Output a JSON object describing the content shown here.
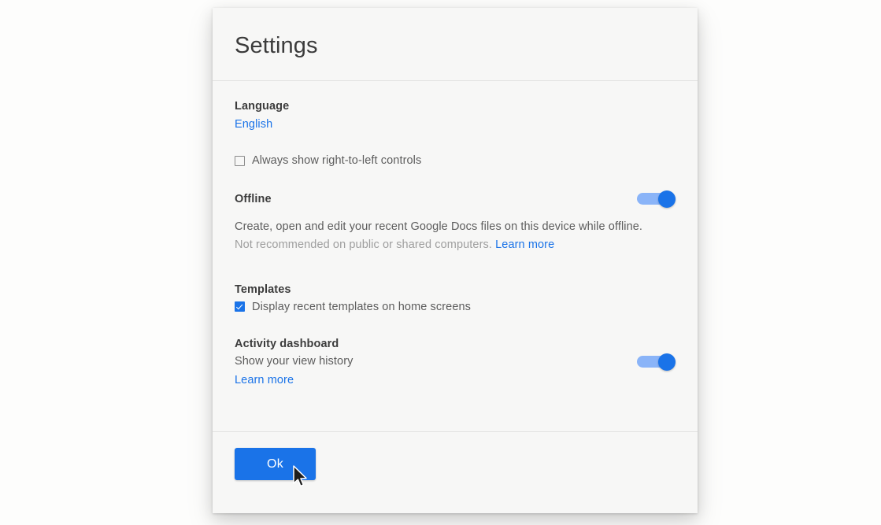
{
  "dialog": {
    "title": "Settings",
    "language": {
      "label": "Language",
      "value": "English",
      "rtl_checkbox_label": "Always show right-to-left controls",
      "rtl_checked": false
    },
    "offline": {
      "label": "Offline",
      "toggle_state": "on",
      "description": "Create, open and edit your recent Google Docs files on this device while offline.",
      "warning": "Not recommended on public or shared computers.",
      "learn_more": "Learn more"
    },
    "templates": {
      "label": "Templates",
      "checkbox_label": "Display recent templates on home screens",
      "checked": true
    },
    "activity_dashboard": {
      "label": "Activity dashboard",
      "subtitle": "Show your view history",
      "learn_more": "Learn more",
      "toggle_state": "on"
    },
    "footer": {
      "ok_label": "Ok"
    }
  },
  "colors": {
    "accent": "#1a73e8",
    "track": "#8ab4f8",
    "dialog_bg": "#f7f7f6",
    "page_bg": "#fdfdfc",
    "text": "#3c3c3c",
    "muted": "#9e9e9e"
  },
  "cursor": {
    "icon": "arrow-pointer-cursor"
  }
}
